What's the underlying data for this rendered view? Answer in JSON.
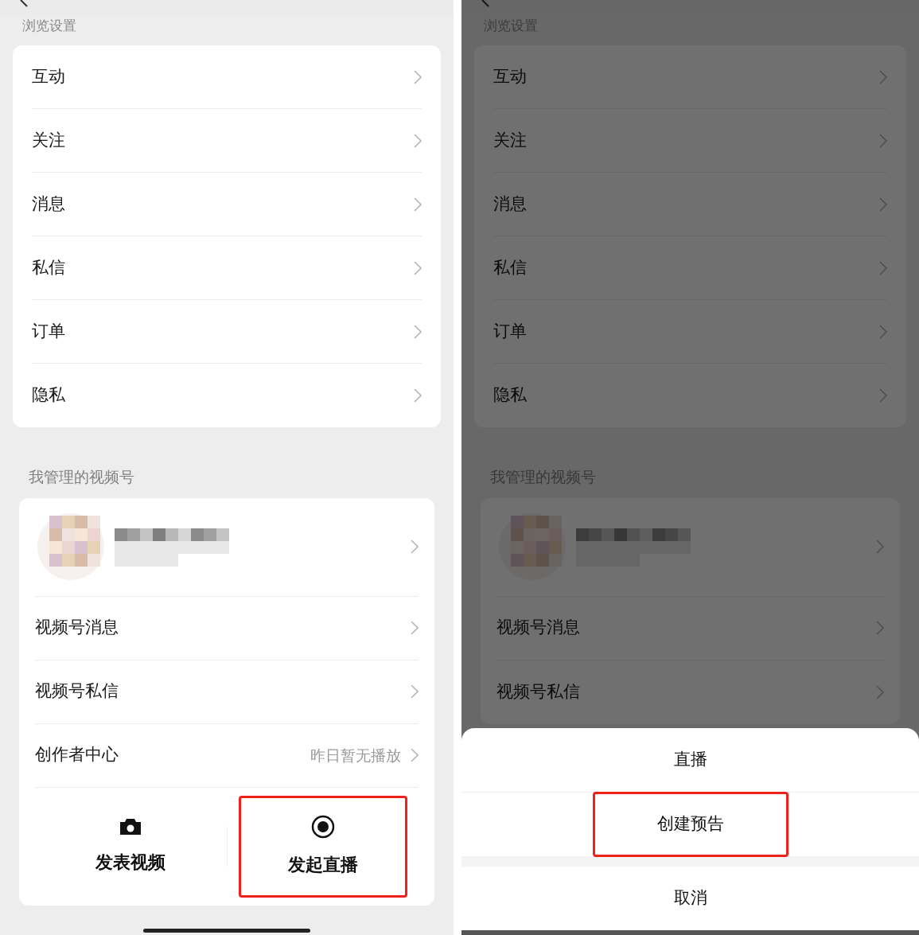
{
  "panels": [
    {
      "kind": "page",
      "section_title": "浏览设置",
      "settings_items": [
        {
          "label": "互动"
        },
        {
          "label": "关注"
        },
        {
          "label": "消息"
        },
        {
          "label": "私信"
        },
        {
          "label": "订单"
        },
        {
          "label": "隐私"
        }
      ],
      "managed_title": "我管理的视频号",
      "channel_items": [
        {
          "label": "视频号消息"
        },
        {
          "label": "视频号私信"
        },
        {
          "label": "创作者中心",
          "value": "昨日暂无播放"
        }
      ],
      "actions": [
        {
          "kind": "camera",
          "label": "发表视频",
          "highlighted": false
        },
        {
          "kind": "live",
          "label": "发起直播",
          "highlighted": true
        }
      ]
    },
    {
      "kind": "sheet",
      "section_title": "浏览设置",
      "settings_items": [
        {
          "label": "互动"
        },
        {
          "label": "关注"
        },
        {
          "label": "消息"
        },
        {
          "label": "私信"
        },
        {
          "label": "订单"
        },
        {
          "label": "隐私"
        }
      ],
      "managed_title": "我管理的视频号",
      "channel_items": [
        {
          "label": "视频号消息"
        },
        {
          "label": "视频号私信"
        }
      ],
      "sheet_options": [
        {
          "label": "直播",
          "highlighted": false
        },
        {
          "label": "创建预告",
          "highlighted": true
        }
      ],
      "cancel": "取消"
    }
  ]
}
